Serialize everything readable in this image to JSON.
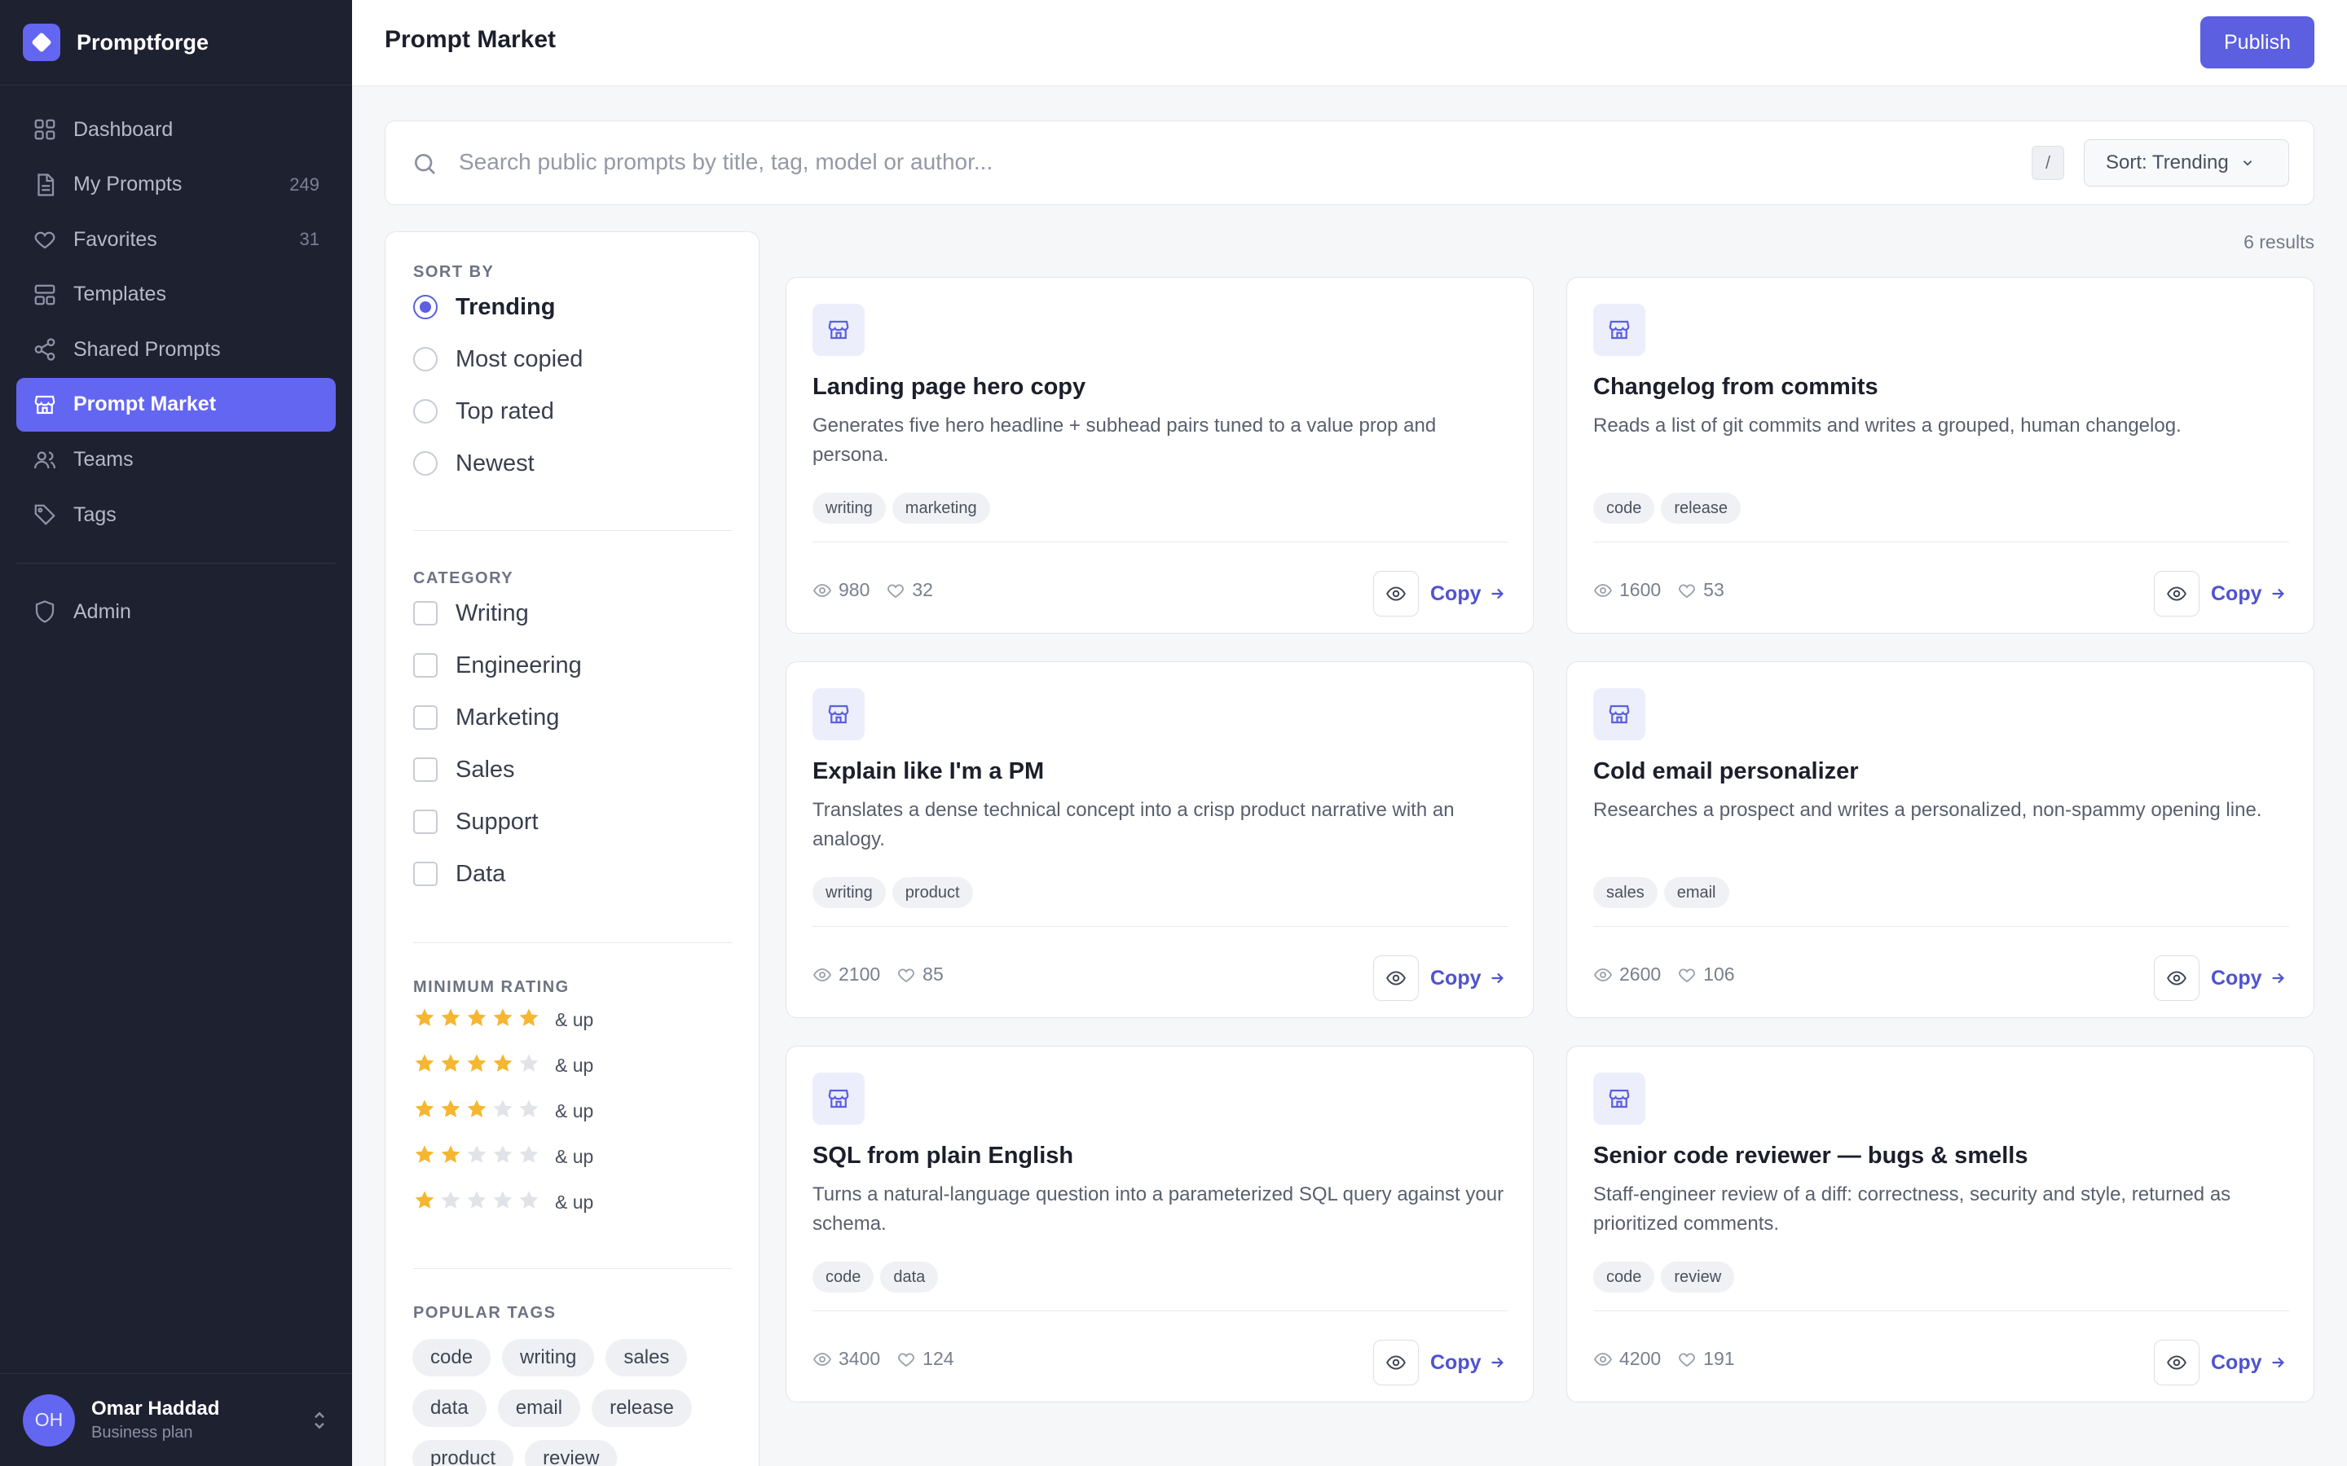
{
  "app": {
    "name": "Promptforge"
  },
  "sidebar": {
    "items": [
      {
        "label": "Dashboard",
        "count": ""
      },
      {
        "label": "My Prompts",
        "count": "249"
      },
      {
        "label": "Favorites",
        "count": "31"
      },
      {
        "label": "Templates",
        "count": ""
      },
      {
        "label": "Shared Prompts",
        "count": ""
      },
      {
        "label": "Prompt Market",
        "count": "",
        "active": true
      },
      {
        "label": "Teams",
        "count": ""
      },
      {
        "label": "Tags",
        "count": ""
      }
    ],
    "admin": {
      "label": "Admin"
    },
    "user": {
      "initials": "OH",
      "name": "Omar Haddad",
      "plan": "Business plan"
    }
  },
  "header": {
    "title": "Prompt Market",
    "publish_label": "Publish"
  },
  "search": {
    "placeholder": "Search public prompts by title, tag, model or author...",
    "shortcut": "/",
    "sort_label": "Sort: Trending"
  },
  "filters": {
    "sort_title": "SORT BY",
    "sort_options": [
      "Trending",
      "Most copied",
      "Top rated",
      "Newest"
    ],
    "sort_selected": "Trending",
    "category_title": "CATEGORY",
    "categories": [
      "Writing",
      "Engineering",
      "Marketing",
      "Sales",
      "Support",
      "Data"
    ],
    "rating_title": "MINIMUM RATING",
    "rating_suffix": "& up",
    "ratings": [
      5,
      4,
      3,
      2,
      1
    ],
    "tags_title": "POPULAR TAGS",
    "tags": [
      "code",
      "writing",
      "sales",
      "data",
      "email",
      "release",
      "product",
      "review"
    ]
  },
  "results": {
    "count_label": "6 results",
    "copy_label": "Copy",
    "cards": [
      {
        "title": "Landing page hero copy",
        "desc": "Generates five hero headline + subhead pairs tuned to a value prop and persona.",
        "tags": [
          "writing",
          "marketing"
        ],
        "views": "980",
        "likes": "32"
      },
      {
        "title": "Changelog from commits",
        "desc": "Reads a list of git commits and writes a grouped, human changelog.",
        "tags": [
          "code",
          "release"
        ],
        "views": "1600",
        "likes": "53"
      },
      {
        "title": "Explain like I'm a PM",
        "desc": "Translates a dense technical concept into a crisp product narrative with an analogy.",
        "tags": [
          "writing",
          "product"
        ],
        "views": "2100",
        "likes": "85"
      },
      {
        "title": "Cold email personalizer",
        "desc": "Researches a prospect and writes a personalized, non-spammy opening line.",
        "tags": [
          "sales",
          "email"
        ],
        "views": "2600",
        "likes": "106"
      },
      {
        "title": "SQL from plain English",
        "desc": "Turns a natural-language question into a parameterized SQL query against your schema.",
        "tags": [
          "code",
          "data"
        ],
        "views": "3400",
        "likes": "124"
      },
      {
        "title": "Senior code reviewer — bugs & smells",
        "desc": "Staff-engineer review of a diff: correctness, security and style, returned as prioritized comments.",
        "tags": [
          "code",
          "review"
        ],
        "views": "4200",
        "likes": "191"
      }
    ]
  },
  "colors": {
    "accent": "#5b5fe0",
    "sidebar_bg": "#1e2130",
    "star": "#f5b731",
    "star_empty": "#e1e3e8"
  },
  "icons": {
    "nav": [
      "grid-icon",
      "document-icon",
      "heart-icon",
      "template-icon",
      "share-icon",
      "store-icon",
      "users-icon",
      "tag-icon"
    ],
    "admin": "shield-icon",
    "card": "store-icon"
  }
}
